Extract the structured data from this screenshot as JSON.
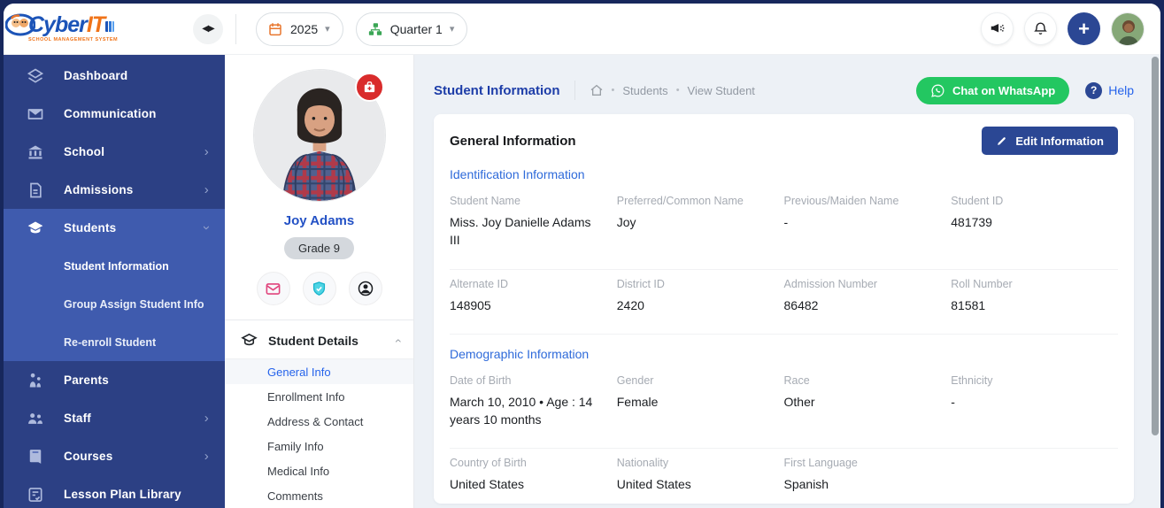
{
  "glyphs": {
    "chevron": "›",
    "caret": "▾",
    "collapse": "◀▶",
    "bullet": "•",
    "plus": "+",
    "question": "?"
  },
  "colors": {
    "sidebar": "#2c4084",
    "sidebar_active_section": "#3f5bae",
    "accent_navy": "#2b4794",
    "link_blue": "#2563eb",
    "section_blue": "#2e6ada",
    "whatsapp_green": "#23c761",
    "alert_red": "#d92c2c",
    "main_bg": "#edf1f6"
  },
  "topbar": {
    "brand_cyber": "Cyber",
    "brand_it": "IT",
    "tagline": "SCHOOL MANAGEMENT SYSTEM",
    "year": "2025",
    "quarter": "Quarter 1"
  },
  "sidebar": {
    "items": [
      {
        "label": "Dashboard"
      },
      {
        "label": "Communication"
      },
      {
        "label": "School"
      },
      {
        "label": "Admissions"
      },
      {
        "label": "Students"
      },
      {
        "label": "Parents"
      },
      {
        "label": "Staff"
      },
      {
        "label": "Courses"
      },
      {
        "label": "Lesson Plan Library"
      }
    ],
    "students_submenu": [
      {
        "label": "Student Information"
      },
      {
        "label": "Group Assign Student Info"
      },
      {
        "label": "Re-enroll Student"
      }
    ]
  },
  "profile": {
    "name": "Joy Adams",
    "grade_badge": "Grade 9",
    "menu_title": "Student Details",
    "menu_items": [
      {
        "label": "General Info"
      },
      {
        "label": "Enrollment Info"
      },
      {
        "label": "Address & Contact"
      },
      {
        "label": "Family Info"
      },
      {
        "label": "Medical Info"
      },
      {
        "label": "Comments"
      }
    ]
  },
  "main": {
    "page_title": "Student Information",
    "breadcrumb": {
      "item1": "Students",
      "item2": "View Student"
    },
    "whatsapp_label": "Chat on WhatsApp",
    "help_label": "Help",
    "card": {
      "title": "General Information",
      "edit_label": "Edit Information",
      "sections": [
        {
          "title": "Identification Information",
          "rows": [
            [
              {
                "label": "Student Name",
                "value": "Miss. Joy Danielle Adams III"
              },
              {
                "label": "Preferred/Common Name",
                "value": "Joy"
              },
              {
                "label": "Previous/Maiden Name",
                "value": "-"
              },
              {
                "label": "Student ID",
                "value": "481739"
              }
            ],
            [
              {
                "label": "Alternate ID",
                "value": "148905"
              },
              {
                "label": "District ID",
                "value": "2420"
              },
              {
                "label": "Admission Number",
                "value": "86482"
              },
              {
                "label": "Roll Number",
                "value": "81581"
              }
            ]
          ]
        },
        {
          "title": "Demographic Information",
          "rows": [
            [
              {
                "label": "Date of Birth",
                "value": "March 10, 2010 • Age : 14 years 10 months"
              },
              {
                "label": "Gender",
                "value": "Female"
              },
              {
                "label": "Race",
                "value": "Other"
              },
              {
                "label": "Ethnicity",
                "value": "-"
              }
            ],
            [
              {
                "label": "Country of Birth",
                "value": "United States"
              },
              {
                "label": "Nationality",
                "value": "United States"
              },
              {
                "label": "First Language",
                "value": "Spanish"
              }
            ]
          ]
        }
      ]
    }
  }
}
